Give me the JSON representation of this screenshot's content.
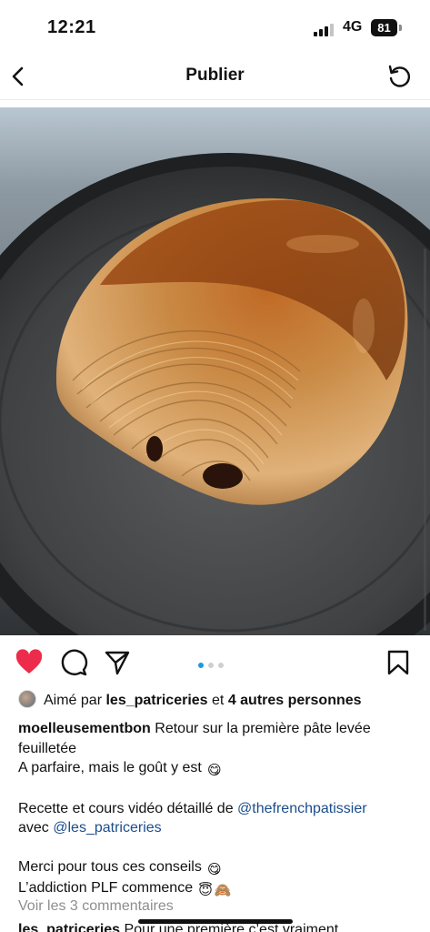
{
  "status_bar": {
    "time": "12:21",
    "network": "4G",
    "battery": "81"
  },
  "nav": {
    "title": "Publier",
    "back_icon": "chevron-left-icon",
    "refresh_icon": "refresh-icon"
  },
  "post": {
    "image_alt": "pain au chocolat",
    "carousel": {
      "count": 3,
      "active": 1
    },
    "actions": {
      "like_icon": "heart-filled-icon",
      "like_color": "#ed2c4b",
      "comment_icon": "comment-icon",
      "share_icon": "send-icon",
      "save_icon": "bookmark-icon"
    },
    "likes": {
      "prefix": "Aimé par",
      "user": "les_patriceries",
      "middle": "et",
      "others": "4 autres personnes"
    },
    "caption": {
      "username": "moelleusementbon",
      "line1": "Retour sur la première pâte levée feuilletée",
      "line2": "A parfaire, mais le goût y est",
      "line3_prefix": "Recette et cours vidéo détaillé de",
      "mention1": "@thefrenchpatissier",
      "line4_prefix": "avec",
      "mention2": "@les_patriceries",
      "line5": "Merci pour tous ces conseils",
      "line6": "L’addiction PLF commence",
      "emoji_yum": "😋",
      "emoji_halo": "😇",
      "emoji_monkey": "🙈"
    },
    "view_comments": "Voir les 3 commentaires",
    "next_comment": {
      "username": "les_patriceries",
      "text": "Pour une première c’est vraiment"
    }
  }
}
